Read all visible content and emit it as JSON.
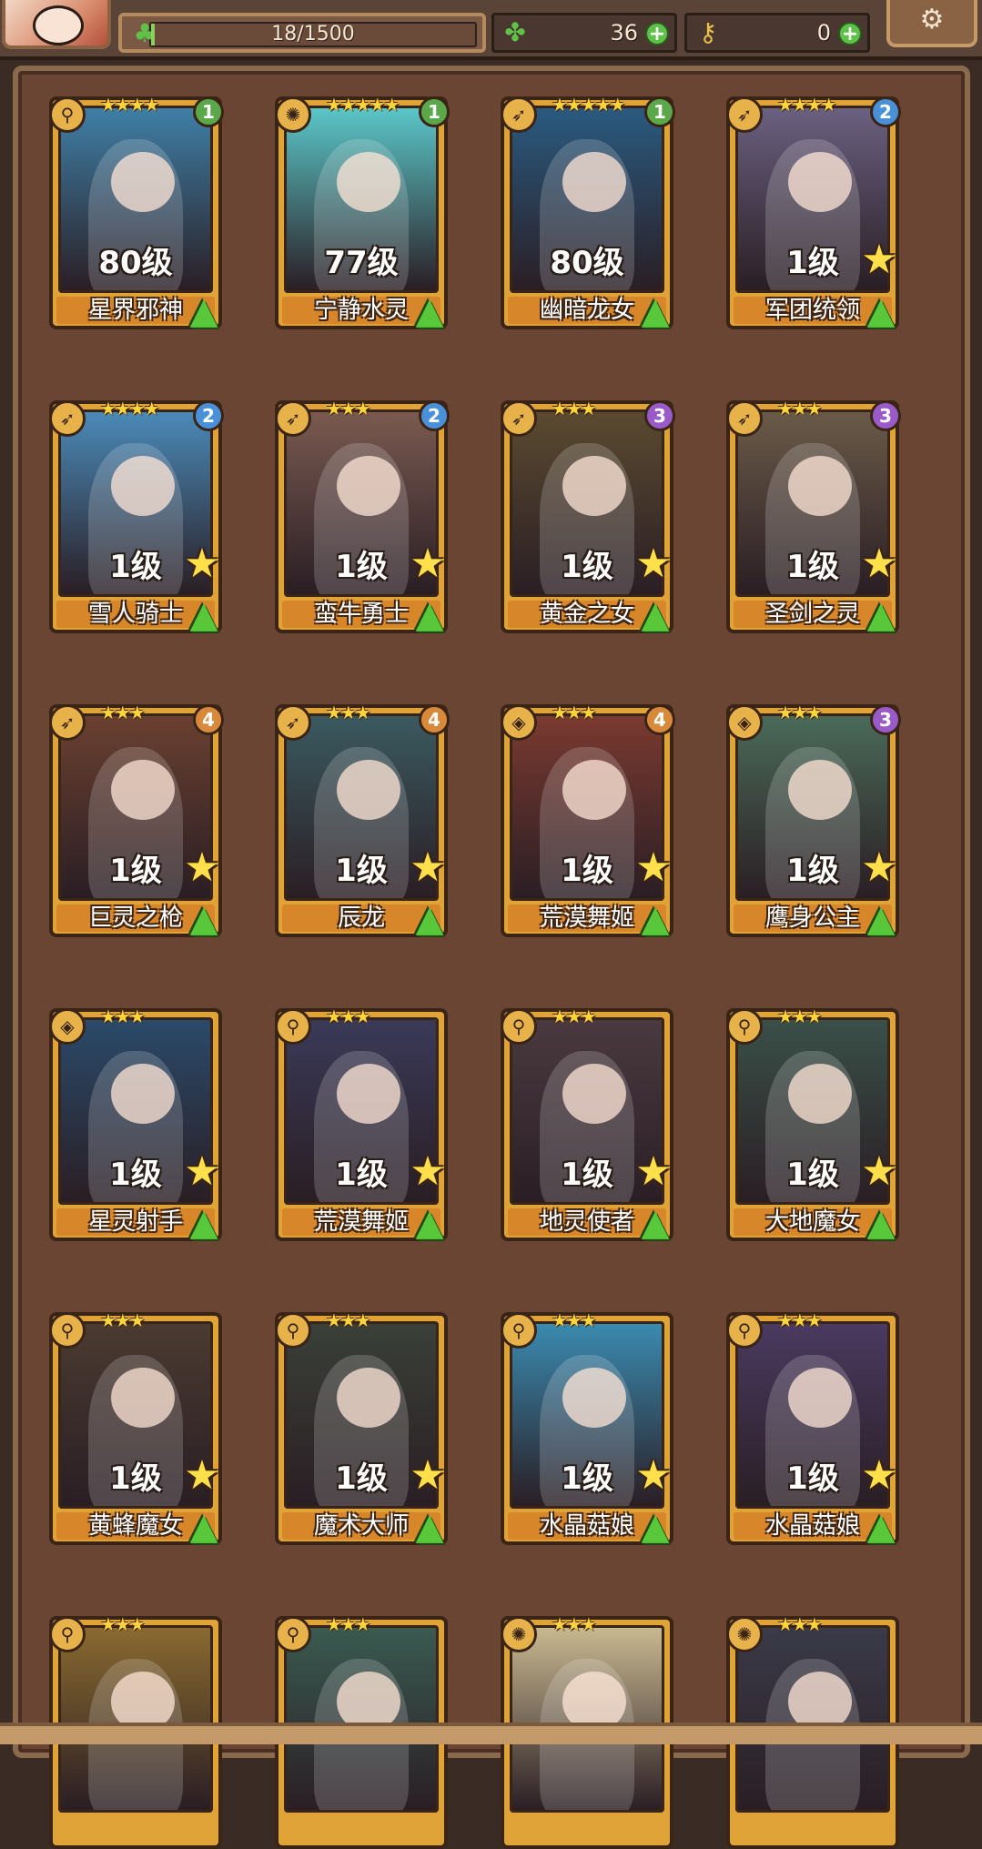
{
  "top": {
    "exp_text": "18/1500",
    "exp_progress": 0.012,
    "clover_count": "36",
    "key_count": "0",
    "plus_label": "+",
    "gear_icon": "gear-icon",
    "clover_icon": "clover-icon",
    "key_icon": "key-icon"
  },
  "cards": [
    {
      "name": "星界邪神",
      "level": "80级",
      "stars": "★★★★",
      "badge": "1",
      "badge_color": "#5aa84a",
      "art_color": "#3f7fa6",
      "type_icon": "staff-icon",
      "show_star": false
    },
    {
      "name": "宁静水灵",
      "level": "77级",
      "stars": "★★★★★",
      "badge": "1",
      "badge_color": "#5aa84a",
      "art_color": "#5ac6c8",
      "type_icon": "orb-icon",
      "show_star": false
    },
    {
      "name": "幽暗龙女",
      "level": "80级",
      "stars": "★★★★★",
      "badge": "1",
      "badge_color": "#5aa84a",
      "art_color": "#2a5a80",
      "type_icon": "bow-icon",
      "show_star": false
    },
    {
      "name": "军团统领",
      "level": "1级",
      "stars": "★★★★",
      "badge": "2",
      "badge_color": "#4a90d8",
      "art_color": "#6a6080",
      "type_icon": "bow-icon",
      "show_star": true
    },
    {
      "name": "雪人骑士",
      "level": "1级",
      "stars": "★★★★",
      "badge": "2",
      "badge_color": "#4a90d8",
      "art_color": "#4a8ab8",
      "type_icon": "bow-icon",
      "show_star": true
    },
    {
      "name": "蛮牛勇士",
      "level": "1级",
      "stars": "★★★",
      "badge": "2",
      "badge_color": "#4a90d8",
      "art_color": "#7a5a50",
      "type_icon": "bow-icon",
      "show_star": true
    },
    {
      "name": "黄金之女",
      "level": "1级",
      "stars": "★★★",
      "badge": "3",
      "badge_color": "#9a5ac8",
      "art_color": "#5a4a30",
      "type_icon": "bow-icon",
      "show_star": true
    },
    {
      "name": "圣剑之灵",
      "level": "1级",
      "stars": "★★★",
      "badge": "3",
      "badge_color": "#9a5ac8",
      "art_color": "#6a5a48",
      "type_icon": "bow-icon",
      "show_star": true
    },
    {
      "name": "巨灵之枪",
      "level": "1级",
      "stars": "★★★",
      "badge": "4",
      "badge_color": "#d88a3a",
      "art_color": "#6a4030",
      "type_icon": "bow-icon",
      "show_star": true
    },
    {
      "name": "辰龙",
      "level": "1级",
      "stars": "★★★",
      "badge": "4",
      "badge_color": "#d88a3a",
      "art_color": "#3a5a60",
      "type_icon": "bow-icon",
      "show_star": true
    },
    {
      "name": "荒漠舞姬",
      "level": "1级",
      "stars": "★★★",
      "badge": "4",
      "badge_color": "#d88a3a",
      "art_color": "#7a3a30",
      "type_icon": "shield-icon",
      "show_star": true
    },
    {
      "name": "鹰身公主",
      "level": "1级",
      "stars": "★★★",
      "badge": "3",
      "badge_color": "#9a5ac8",
      "art_color": "#4a6a58",
      "type_icon": "shield-icon",
      "show_star": true
    },
    {
      "name": "星灵射手",
      "level": "1级",
      "stars": "★★★",
      "badge": "",
      "badge_color": "",
      "art_color": "#2a4a6a",
      "type_icon": "shield-icon",
      "show_star": true
    },
    {
      "name": "荒漠舞姬",
      "level": "1级",
      "stars": "★★★",
      "badge": "",
      "badge_color": "",
      "art_color": "#3a3a58",
      "type_icon": "staff-icon",
      "show_star": true
    },
    {
      "name": "地灵使者",
      "level": "1级",
      "stars": "★★★",
      "badge": "",
      "badge_color": "",
      "art_color": "#4a3a40",
      "type_icon": "staff-icon",
      "show_star": true
    },
    {
      "name": "大地魔女",
      "level": "1级",
      "stars": "★★★",
      "badge": "",
      "badge_color": "",
      "art_color": "#3a5048",
      "type_icon": "staff-icon",
      "show_star": true
    },
    {
      "name": "黄蜂魔女",
      "level": "1级",
      "stars": "★★★",
      "badge": "",
      "badge_color": "",
      "art_color": "#4a3a30",
      "type_icon": "staff-icon",
      "show_star": true
    },
    {
      "name": "魔术大师",
      "level": "1级",
      "stars": "★★★",
      "badge": "",
      "badge_color": "",
      "art_color": "#3a4038",
      "type_icon": "staff-icon",
      "show_star": true
    },
    {
      "name": "水晶菇娘",
      "level": "1级",
      "stars": "★★★",
      "badge": "",
      "badge_color": "",
      "art_color": "#3a8ab0",
      "type_icon": "staff-icon",
      "show_star": true
    },
    {
      "name": "水晶菇娘",
      "level": "1级",
      "stars": "★★★",
      "badge": "",
      "badge_color": "",
      "art_color": "#4a3a60",
      "type_icon": "staff-icon",
      "show_star": true
    },
    {
      "name": "",
      "level": "",
      "stars": "★★★",
      "badge": "",
      "badge_color": "",
      "art_color": "#8a6a30",
      "type_icon": "staff-icon",
      "show_star": false
    },
    {
      "name": "",
      "level": "",
      "stars": "★★★",
      "badge": "",
      "badge_color": "",
      "art_color": "#3a5a50",
      "type_icon": "staff-icon",
      "show_star": false
    },
    {
      "name": "",
      "level": "",
      "stars": "★★★",
      "badge": "",
      "badge_color": "",
      "art_color": "#c8b890",
      "type_icon": "orb-icon",
      "show_star": false
    },
    {
      "name": "",
      "level": "",
      "stars": "★★★",
      "badge": "",
      "badge_color": "",
      "art_color": "#3a3a48",
      "type_icon": "orb-icon",
      "show_star": false
    }
  ]
}
